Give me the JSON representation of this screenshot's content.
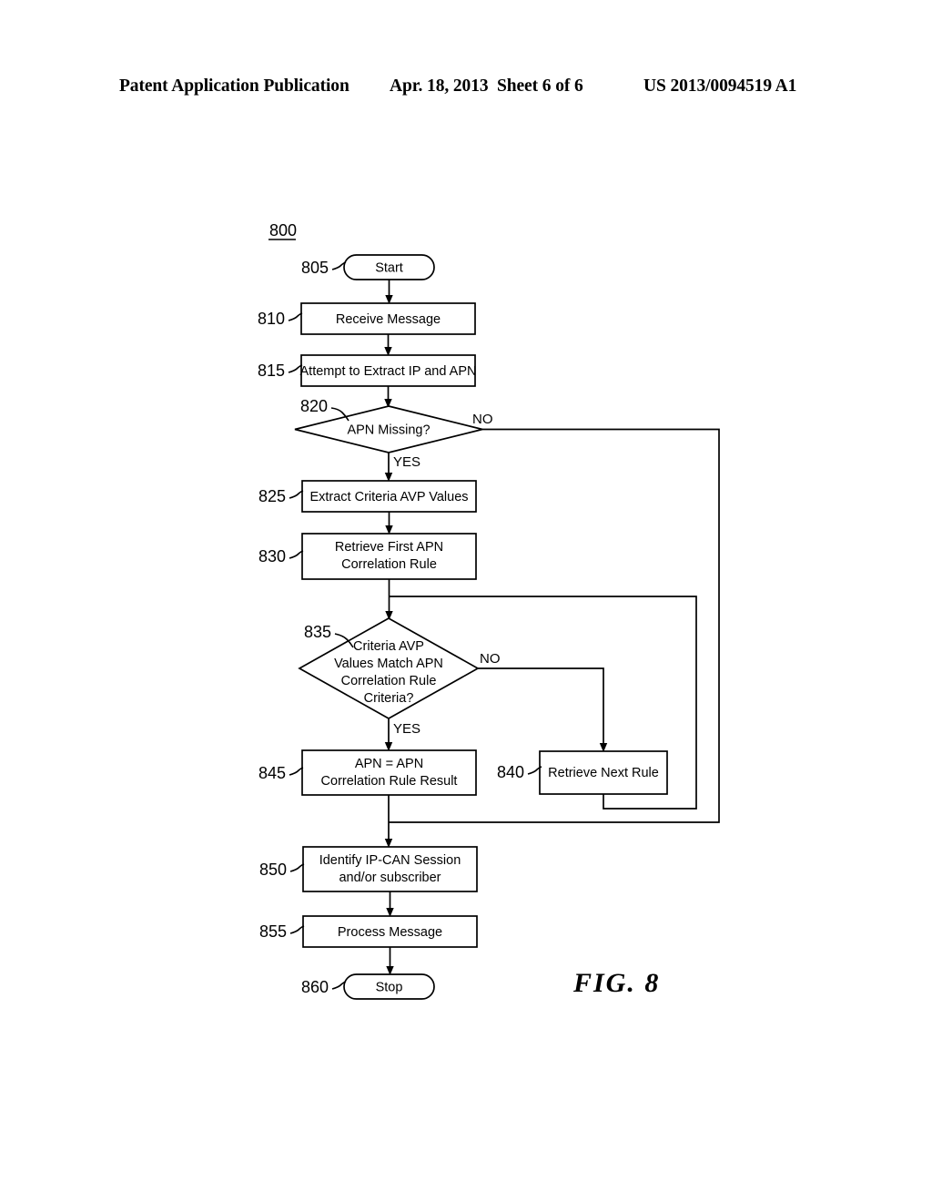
{
  "header": {
    "publication": "Patent Application Publication",
    "date": "Apr. 18, 2013",
    "sheet": "Sheet 6 of 6",
    "number": "US 2013/0094519 A1"
  },
  "figure": {
    "caption": "FIG.  8",
    "diagram_ref": "800"
  },
  "flowchart": {
    "nodes": [
      {
        "ref": "805",
        "type": "terminator",
        "label": "Start"
      },
      {
        "ref": "810",
        "type": "process",
        "label": "Receive Message"
      },
      {
        "ref": "815",
        "type": "process",
        "label": "Attempt to Extract IP and APN"
      },
      {
        "ref": "820",
        "type": "decision",
        "label": "APN Missing?"
      },
      {
        "ref": "825",
        "type": "process",
        "label": "Extract Criteria AVP Values"
      },
      {
        "ref": "830",
        "type": "process",
        "label_line1": "Retrieve First APN",
        "label_line2": "Correlation Rule"
      },
      {
        "ref": "835",
        "type": "decision",
        "label_line1": "Criteria AVP",
        "label_line2": "Values Match APN",
        "label_line3": "Correlation Rule",
        "label_line4": "Criteria?"
      },
      {
        "ref": "840",
        "type": "process",
        "label": "Retrieve Next Rule"
      },
      {
        "ref": "845",
        "type": "process",
        "label_line1": "APN = APN",
        "label_line2": "Correlation Rule Result"
      },
      {
        "ref": "850",
        "type": "process",
        "label_line1": "Identify IP-CAN Session",
        "label_line2": "and/or subscriber"
      },
      {
        "ref": "855",
        "type": "process",
        "label": "Process Message"
      },
      {
        "ref": "860",
        "type": "terminator",
        "label": "Stop"
      }
    ],
    "branch_labels": {
      "d820_no": "NO",
      "d820_yes": "YES",
      "d835_no": "NO",
      "d835_yes": "YES"
    }
  }
}
